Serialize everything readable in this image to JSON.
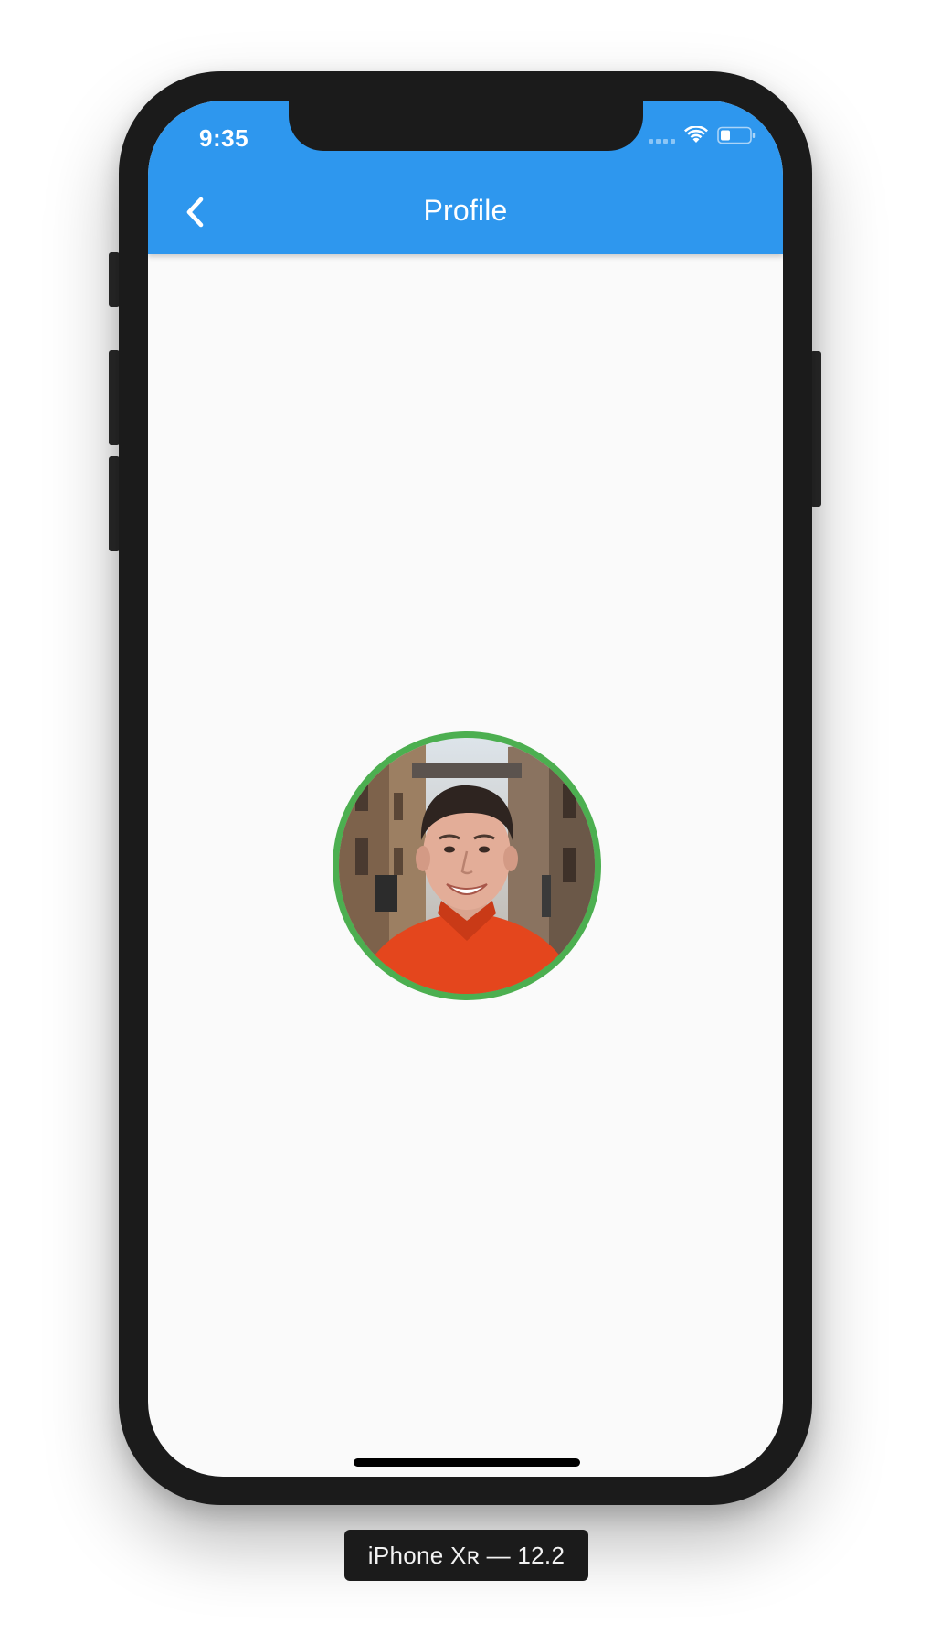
{
  "status_bar": {
    "time": "9:35"
  },
  "app_bar": {
    "title": "Profile",
    "back_icon": "chevron-left-icon",
    "background_color": "#2e97ee"
  },
  "profile": {
    "avatar_border_color": "#4caf50"
  },
  "device_label": "iPhone Xʀ — 12.2"
}
